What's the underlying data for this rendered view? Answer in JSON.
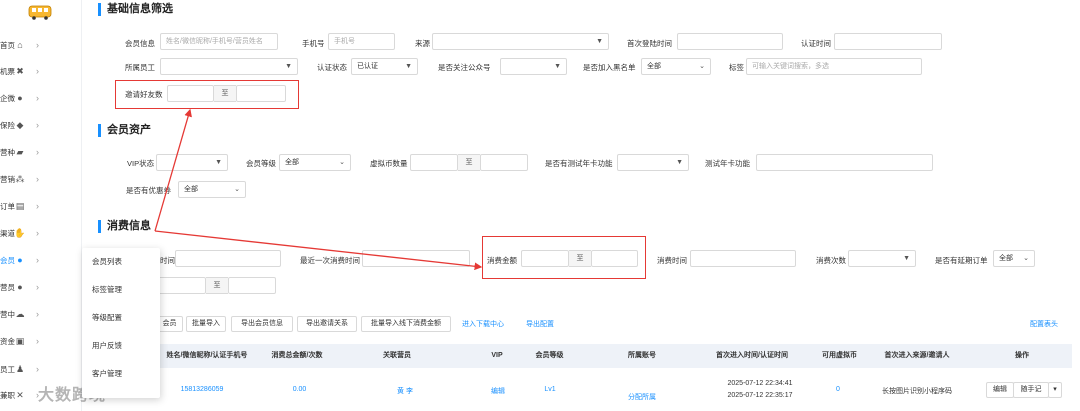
{
  "sidebar": {
    "items": [
      {
        "icon": "home-icon",
        "label": "首页"
      },
      {
        "icon": "ticket-icon",
        "label": "机票"
      },
      {
        "icon": "enterprise-icon",
        "label": "企微"
      },
      {
        "icon": "shield-icon",
        "label": "保险"
      },
      {
        "icon": "hat-icon",
        "label": "营种"
      },
      {
        "icon": "network-icon",
        "label": "营销"
      },
      {
        "icon": "order-icon",
        "label": "订单"
      },
      {
        "icon": "handshake-icon",
        "label": "渠道"
      },
      {
        "icon": "user-icon",
        "label": "会员"
      },
      {
        "icon": "user-circle-icon",
        "label": "营员"
      },
      {
        "icon": "cloud-icon",
        "label": "营中"
      },
      {
        "icon": "money-icon",
        "label": "资金"
      },
      {
        "icon": "staff-icon",
        "label": "员工"
      },
      {
        "icon": "cross-icon",
        "label": "兼职"
      }
    ],
    "submenu": [
      "会员列表",
      "标签管理",
      "等级配置",
      "用户反馈",
      "客户管理"
    ]
  },
  "basic": {
    "title": "基础信息筛选",
    "member_info_label": "会员信息",
    "member_info_placeholder": "姓名/微信昵称/手机号/营员姓名",
    "phone_label": "手机号",
    "phone_placeholder": "手机号",
    "source_label": "来源",
    "first_login_label": "首次登陆时间",
    "auth_time_label": "认证时间",
    "staff_label": "所属员工",
    "auth_status_label": "认证状态",
    "auth_status_value": "已认证",
    "follow_label": "是否关注公众号",
    "blacklist_label": "是否加入黑名单",
    "blacklist_value": "全部",
    "tag_label": "标签",
    "tag_placeholder": "可输入关键词搜索，多选",
    "invite_label": "邀请好友数",
    "to": "至"
  },
  "assets": {
    "title": "会员资产",
    "vip_label": "VIP状态",
    "level_label": "会员等级",
    "level_value": "全部",
    "coin_label": "虚拟币数量",
    "trial_card_label": "是否有测试年卡功能",
    "trial_func_label": "测试年卡功能",
    "coupon_label": "是否有优惠券",
    "coupon_value": "全部"
  },
  "consume": {
    "title": "消费信息",
    "first_consume_label": "时间",
    "last_consume_label": "最近一次消费时间",
    "amount_label": "消费金额",
    "consume_time_label": "消费时间",
    "consume_count_label": "消费次数",
    "delay_label": "是否有延期订单",
    "delay_value": "全部"
  },
  "toolbar": {
    "btn_member": "会员",
    "btn_batch_import": "批量导入",
    "btn_export_member": "导出会员信息",
    "btn_export_invite": "导出邀请关系",
    "btn_batch_offline": "批量导入线下消费金额",
    "link_download": "进入下载中心",
    "link_export_config": "导出配置",
    "link_header_config": "配置表头"
  },
  "table": {
    "headers": [
      "姓名/微信昵称/认证手机号",
      "消费总金额/次数",
      "关联营员",
      "VIP",
      "会员等级",
      "所属账号",
      "首次进入时间/认证时间",
      "可用虚拟币",
      "首次进入来源/邀请人",
      "操作"
    ],
    "row": {
      "phone": "15813286059",
      "amount": "0.00",
      "camper": "黄 李",
      "vip": "编辑",
      "level": "Lv1",
      "account": "分配所属",
      "time1": "2025-07-12 22:34:41",
      "time2": "2025-07-12 22:35:17",
      "coin": "0",
      "source": "长按图片识别小程序码",
      "edit": "编辑",
      "follow": "随手记"
    }
  },
  "watermark": "大数跨境"
}
